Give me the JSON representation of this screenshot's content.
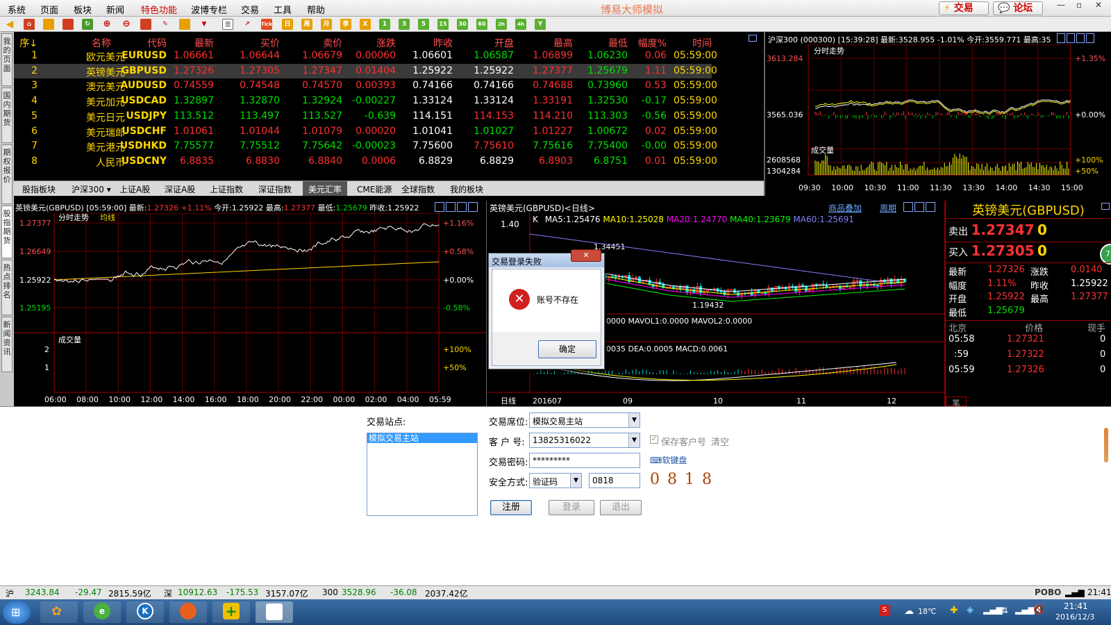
{
  "menu": [
    "系统",
    "页面",
    "板块",
    "新闻",
    "特色功能",
    "波博专栏",
    "交易",
    "工具",
    "帮助"
  ],
  "app_title": "博易大师模拟",
  "top_buttons": {
    "trade": "交易",
    "forum": "论坛"
  },
  "side_tabs": [
    "我的页面",
    "国内期货",
    "期权报价",
    "股指期货",
    "热点排名",
    "新闻资讯"
  ],
  "quote_headers": [
    "序",
    "名称",
    "代码",
    "最新",
    "买价",
    "卖价",
    "涨跌",
    "昨收",
    "开盘",
    "最高",
    "最低",
    "幅度%",
    "时间"
  ],
  "quotes": [
    {
      "seq": "1",
      "name": "欧元美元",
      "code": "EURUSD",
      "last": "1.06661",
      "bid": "1.06644",
      "ask": "1.06679",
      "chg": "0.00060",
      "pc": "1.06601",
      "op": "1.06587",
      "hi": "1.06899",
      "lo": "1.06230",
      "amp": "0.06",
      "tm": "05:59:00"
    },
    {
      "seq": "2",
      "name": "英镑美元",
      "code": "GBPUSD",
      "last": "1.27326",
      "bid": "1.27305",
      "ask": "1.27347",
      "chg": "0.01404",
      "pc": "1.25922",
      "op": "1.25922",
      "hi": "1.27377",
      "lo": "1.25679",
      "amp": "1.11",
      "tm": "05:59:00"
    },
    {
      "seq": "3",
      "name": "澳元美元",
      "code": "AUDUSD",
      "last": "0.74559",
      "bid": "0.74548",
      "ask": "0.74570",
      "chg": "0.00393",
      "pc": "0.74166",
      "op": "0.74166",
      "hi": "0.74688",
      "lo": "0.73960",
      "amp": "0.53",
      "tm": "05:59:00"
    },
    {
      "seq": "4",
      "name": "美元加元",
      "code": "USDCAD",
      "last": "1.32897",
      "bid": "1.32870",
      "ask": "1.32924",
      "chg": "-0.00227",
      "pc": "1.33124",
      "op": "1.33124",
      "hi": "1.33191",
      "lo": "1.32530",
      "amp": "-0.17",
      "tm": "05:59:00"
    },
    {
      "seq": "5",
      "name": "美元日元",
      "code": "USDJPY",
      "last": "113.512",
      "bid": "113.497",
      "ask": "113.527",
      "chg": "-0.639",
      "pc": "114.151",
      "op": "114.153",
      "hi": "114.210",
      "lo": "113.303",
      "amp": "-0.56",
      "tm": "05:59:00"
    },
    {
      "seq": "6",
      "name": "美元瑞郎",
      "code": "USDCHF",
      "last": "1.01061",
      "bid": "1.01044",
      "ask": "1.01079",
      "chg": "0.00020",
      "pc": "1.01041",
      "op": "1.01027",
      "hi": "1.01227",
      "lo": "1.00672",
      "amp": "0.02",
      "tm": "05:59:00"
    },
    {
      "seq": "7",
      "name": "美元港元",
      "code": "USDHKD",
      "last": "7.75577",
      "bid": "7.75512",
      "ask": "7.75642",
      "chg": "-0.00023",
      "pc": "7.75600",
      "op": "7.75610",
      "hi": "7.75616",
      "lo": "7.75400",
      "amp": "-0.00",
      "tm": "05:59:00"
    },
    {
      "seq": "8",
      "name": "人民币",
      "code": "USDCNY",
      "last": "6.8835",
      "bid": "6.8830",
      "ask": "6.8840",
      "chg": "0.0006",
      "pc": "6.8829",
      "op": "6.8829",
      "hi": "6.8903",
      "lo": "6.8751",
      "amp": "0.01",
      "tm": "05:59:00"
    }
  ],
  "quote_colors": {
    "1": {
      "last": "red",
      "bid": "red",
      "ask": "red",
      "chg": "red",
      "op": "grn",
      "hi": "red",
      "lo": "grn",
      "amp": "red"
    },
    "2": {
      "last": "red",
      "bid": "red",
      "ask": "red",
      "chg": "red",
      "op": "wht",
      "hi": "red",
      "lo": "grn",
      "amp": "red"
    },
    "3": {
      "last": "red",
      "bid": "red",
      "ask": "red",
      "chg": "red",
      "op": "wht",
      "hi": "red",
      "lo": "grn",
      "amp": "red"
    },
    "4": {
      "last": "grn",
      "bid": "grn",
      "ask": "grn",
      "chg": "grn",
      "op": "wht",
      "hi": "red",
      "lo": "grn",
      "amp": "grn"
    },
    "5": {
      "last": "grn",
      "bid": "grn",
      "ask": "grn",
      "chg": "grn",
      "op": "red",
      "hi": "red",
      "lo": "grn",
      "amp": "grn"
    },
    "6": {
      "last": "red",
      "bid": "red",
      "ask": "red",
      "chg": "red",
      "op": "grn",
      "hi": "red",
      "lo": "grn",
      "amp": "red"
    },
    "7": {
      "last": "grn",
      "bid": "grn",
      "ask": "grn",
      "chg": "grn",
      "op": "red",
      "hi": "grn",
      "lo": "grn",
      "amp": "grn"
    },
    "8": {
      "last": "red",
      "bid": "red",
      "ask": "red",
      "chg": "red",
      "op": "wht",
      "hi": "red",
      "lo": "grn",
      "amp": "red"
    }
  },
  "tabs": [
    "股指板块",
    "沪深300 ▾",
    "上证A股",
    "深证A股",
    "上证指数",
    "深证指数",
    "美元汇率",
    "CME能源",
    "全球指数",
    "我的板块"
  ],
  "hs300": {
    "header": "沪深300 (000300)   [15:39:28] 最新:3528.955  -1.01%  今开:3559.771  最高:35",
    "title": "分时走势",
    "y_labels": [
      "3613.284",
      "3565.036"
    ],
    "pct_labels": [
      "+1.35%",
      "+0.00%"
    ],
    "vol_title": "成交量",
    "vol_labels": [
      "2608568",
      "1304284"
    ],
    "vol_pct": [
      "+100%",
      "+50%"
    ],
    "x_labels": [
      "09:30",
      "10:00",
      "10:30",
      "11:00",
      "11:30",
      "13:30",
      "14:00",
      "14:30",
      "15:00"
    ]
  },
  "gbp_intraday": {
    "header_name": "英镑美元(GBPUSD)",
    "header_time": "[05:59:00]",
    "header_last_label": "最新:",
    "header_last": "1.27326",
    "header_pct": "+1.11%",
    "header_open": "今开:1.25922",
    "header_high_label": "最高:",
    "header_high": "1.27377",
    "header_low_label": "最低:",
    "header_low": "1.25679",
    "header_pc": "昨收:1.25922",
    "title": "分时走势",
    "avg_label": "均线",
    "y_labels": [
      "1.27377",
      "1.26649",
      "1.25922",
      "1.25195"
    ],
    "pct_labels": [
      "+1.16%",
      "+0.58%",
      "+0.00%",
      "-0.58%"
    ],
    "vol_title": "成交量",
    "vol_labels": [
      "2",
      "1"
    ],
    "vol_pct": [
      "+100%",
      "+50%"
    ],
    "x_labels": [
      "06:00",
      "08:00",
      "10:00",
      "12:00",
      "14:00",
      "16:00",
      "18:00",
      "20:00",
      "22:00",
      "00:00",
      "02:00",
      "04:00",
      "05:59"
    ]
  },
  "gbp_daily": {
    "header": "英镑美元(GBPUSD)<日线>",
    "link1": "商品叠加",
    "link2": "周期",
    "ma_k": "K",
    "ma5": "MA5:1.25476",
    "ma10": "MA10:1.25028",
    "ma20": "MA20:1.24770",
    "ma40": "MA40:1.23679",
    "ma60": "MA60:1.25691",
    "y_top": "1.40",
    "hi_note": "1.34451",
    "lo_note": "1.19432",
    "vol_line": "0000  MAVOL1:0.0000   MAVOL2:0.0000",
    "macd_line": "0035  DEA:0.0005  MACD:0.0061",
    "period": "日线",
    "x_labels": [
      "201607",
      "09",
      "10",
      "11",
      "12"
    ]
  },
  "dialog": {
    "title": "交易登录失败",
    "message": "账号不存在",
    "ok": "确定"
  },
  "right_panel": {
    "title": "英镑美元(GBPUSD)",
    "sell_label": "卖出",
    "sell_price": "1.27347",
    "sell_qty": "0",
    "buy_label": "买入",
    "buy_price": "1.27305",
    "buy_qty": "0",
    "badge": "73",
    "rows": [
      [
        "最新",
        "1.27326",
        "涨跌",
        "0.0140"
      ],
      [
        "幅度",
        "1.11%",
        "昨收",
        "1.25922"
      ],
      [
        "开盘",
        "1.25922",
        "最高",
        "1.27377"
      ],
      [
        "最低",
        "1.25679",
        "",
        ""
      ]
    ],
    "tick_headers": [
      "北京",
      "价格",
      "现手"
    ],
    "ticks": [
      [
        "05:58",
        "1.27321",
        "0"
      ],
      [
        ":59",
        "1.27322",
        "0"
      ],
      [
        "05:59",
        "1.27326",
        "0"
      ]
    ],
    "bottom_tab": "笔"
  },
  "login": {
    "station_label": "交易站点:",
    "station_item": "模拟交易主站",
    "seat_label": "交易席位:",
    "seat_value": "模拟交易主站",
    "client_label": "客 户 号:",
    "client_value": "13825316022",
    "save_client": "保存客户号",
    "clear": "清空",
    "password_label": "交易密码:",
    "password_value": "*********",
    "softkb": "软键盘",
    "security_label": "安全方式:",
    "security_value": "验证码",
    "captcha_input": "0818",
    "captcha": "0 8 1 8",
    "register": "注册",
    "login": "登录",
    "exit": "退出"
  },
  "status": {
    "sh_label": "沪",
    "sh_val": "3243.84",
    "sh_chg": "-29.47",
    "sh_amt": "2815.59亿",
    "sz_label": "深",
    "sz_val": "10912.63",
    "sz_chg": "-175.53",
    "sz_amt": "3157.07亿",
    "hs_label": "300",
    "hs_val": "3528.96",
    "hs_chg": "-36.08",
    "hs_amt": "2037.42亿",
    "brand": "POBO",
    "time": "21:41"
  },
  "taskbar": {
    "weather": "18℃",
    "time": "21:41",
    "date": "2016/12/3"
  }
}
